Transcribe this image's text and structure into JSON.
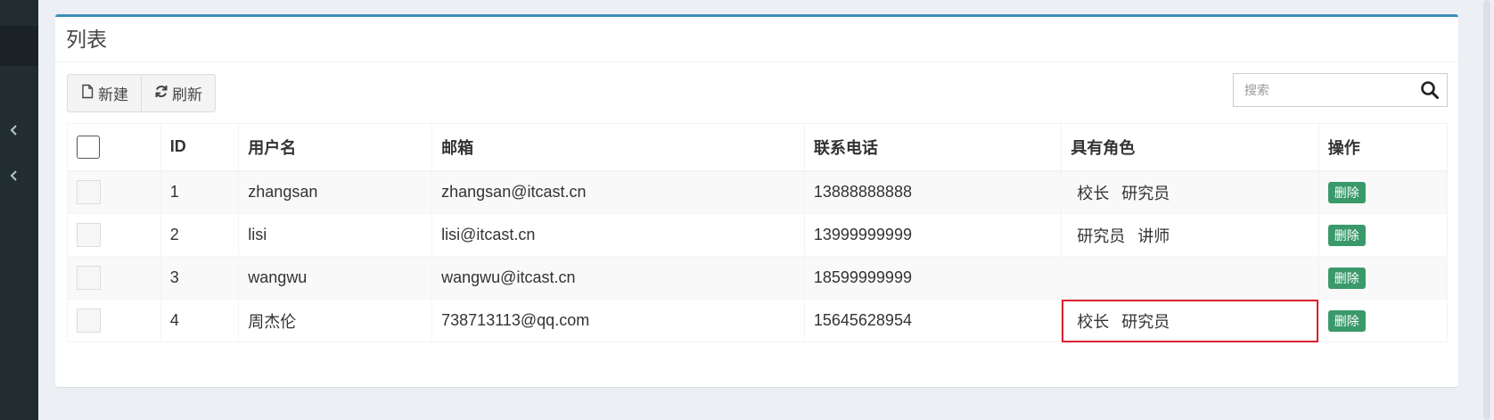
{
  "sidebar": {
    "icons": [
      "chevron-left-icon",
      "chevron-left-icon"
    ]
  },
  "box": {
    "title": "列表"
  },
  "toolbar": {
    "new_label": "新建",
    "refresh_label": "刷新"
  },
  "search": {
    "placeholder": "搜索",
    "value": ""
  },
  "table": {
    "headers": {
      "id": "ID",
      "username": "用户名",
      "email": "邮箱",
      "phone": "联系电话",
      "roles": "具有角色",
      "ops": "操作"
    },
    "rows": [
      {
        "id": "1",
        "username": "zhangsan",
        "email": "zhangsan@itcast.cn",
        "phone": "13888888888",
        "roles": [
          "校长",
          "研究员"
        ],
        "action": "删除"
      },
      {
        "id": "2",
        "username": "lisi",
        "email": "lisi@itcast.cn",
        "phone": "13999999999",
        "roles": [
          "研究员",
          "讲师"
        ],
        "action": "删除"
      },
      {
        "id": "3",
        "username": "wangwu",
        "email": "wangwu@itcast.cn",
        "phone": "18599999999",
        "roles": [
          "",
          ""
        ],
        "action": "删除"
      },
      {
        "id": "4",
        "username": "周杰伦",
        "email": "738713113@qq.com",
        "phone": "15645628954",
        "roles": [
          "校长",
          "研究员"
        ],
        "action": "删除"
      }
    ]
  },
  "colors": {
    "accent": "#3c8dbc",
    "sidebar_bg": "#222d32",
    "delete_button": "#3a996b",
    "highlight_border": "#d9232f"
  }
}
